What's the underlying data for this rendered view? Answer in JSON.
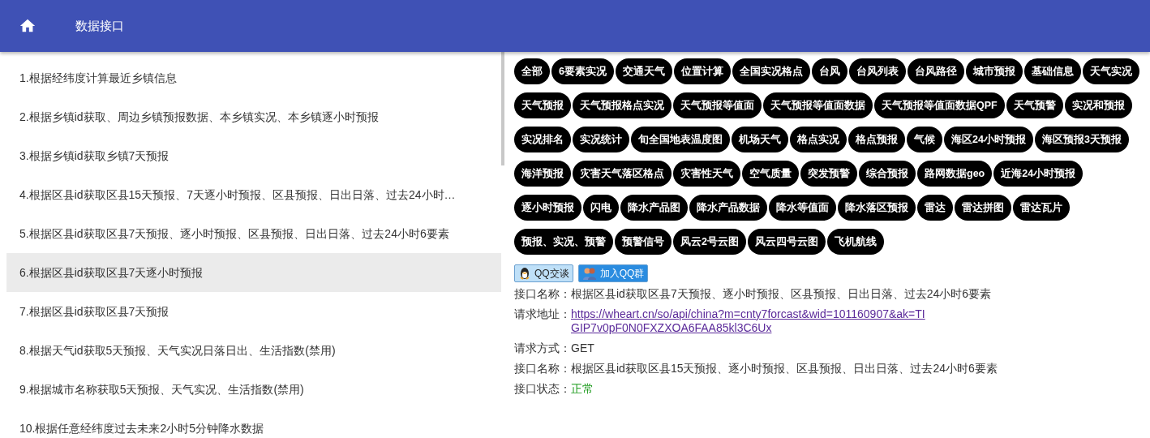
{
  "header": {
    "title": "数据接口"
  },
  "api_list": [
    {
      "label": "1.根据经纬度计算最近乡镇信息",
      "selected": false
    },
    {
      "label": "2.根据乡镇id获取、周边乡镇预报数据、本乡镇实况、本乡镇逐小时预报",
      "selected": false
    },
    {
      "label": "3.根据乡镇id获取乡镇7天预报",
      "selected": false
    },
    {
      "label": "4.根据区县id获取区县15天预报、7天逐小时预报、区县预报、日出日落、过去24小时…",
      "selected": false
    },
    {
      "label": "5.根据区县id获取区县7天预报、逐小时预报、区县预报、日出日落、过去24小时6要素",
      "selected": false
    },
    {
      "label": "6.根据区县id获取区县7天逐小时预报",
      "selected": true
    },
    {
      "label": "7.根据区县id获取区县7天预报",
      "selected": false
    },
    {
      "label": "8.根据天气id获取5天预报、天气实况日落日出、生活指数(禁用)",
      "selected": false
    },
    {
      "label": "9.根据城市名称获取5天预报、天气实况、生活指数(禁用)",
      "selected": false
    },
    {
      "label": "10.根据任意经纬度过去未来2小时5分钟降水数据",
      "selected": false
    }
  ],
  "categories": [
    "全部",
    "6要素实况",
    "交通天气",
    "位置计算",
    "全国实况格点",
    "台风",
    "台风列表",
    "台风路径",
    "城市预报",
    "基础信息",
    "天气实况",
    "天气预报",
    "天气预报格点实况",
    "天气预报等值面",
    "天气预报等值面数据",
    "天气预报等值面数据QPF",
    "天气预警",
    "实况和预报",
    "实况排名",
    "实况统计",
    "旬全国地表温度图",
    "机场天气",
    "格点实况",
    "格点预报",
    "气候",
    "海区24小时预报",
    "海区预报3天预报",
    "海洋预报",
    "灾害天气落区格点",
    "灾害性天气",
    "空气质量",
    "突发预警",
    "综合预报",
    "路网数据geo",
    "近海24小时预报",
    "逐小时预报",
    "闪电",
    "降水产品图",
    "降水产品数据",
    "降水等值面",
    "降水落区预报",
    "雷达",
    "雷达拼图",
    "雷达瓦片",
    "预报、实况、预警",
    "预警信号",
    "风云2号云图",
    "风云四号云图",
    "飞机航线"
  ],
  "contact_buttons": [
    {
      "label": "QQ交谈",
      "kind": "chat"
    },
    {
      "label": "加入QQ群",
      "kind": "group"
    }
  ],
  "details": [
    {
      "label": "接口名称：",
      "value": "根据区县id获取区县7天预报、逐小时预报、区县预报、日出日落、过去24小时6要素",
      "kind": "text"
    },
    {
      "label": "请求地址：",
      "value": "https://wheart.cn/so/api/china?m=cnty7forcast&wid=101160907&ak=TIGIP7v0pF0N0FXZXOA6FAA85kl3C6Ux",
      "kind": "link"
    },
    {
      "label": "请求方式：",
      "value": "GET",
      "kind": "text"
    },
    {
      "label": "接口名称：",
      "value": "根据区县id获取区县15天预报、逐小时预报、区县预报、日出日落、过去24小时6要素",
      "kind": "text"
    },
    {
      "label": "接口状态：",
      "value": "正常",
      "kind": "status"
    }
  ]
}
